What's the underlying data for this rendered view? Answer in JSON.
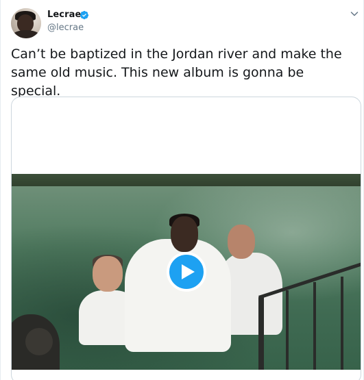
{
  "user": {
    "name": "Lecrae",
    "handle": "@lecrae",
    "verified": true
  },
  "tweet": {
    "text": "Can’t be baptized in the Jordan river and make the same old music. This new album is gonna be special."
  },
  "icons": {
    "verified": "verified-badge-icon",
    "menu": "chevron-down-icon",
    "play": "play-icon"
  },
  "colors": {
    "accent": "#1da1f2",
    "text": "#14171a",
    "secondary_text": "#657786",
    "border": "#ccd6dd"
  }
}
